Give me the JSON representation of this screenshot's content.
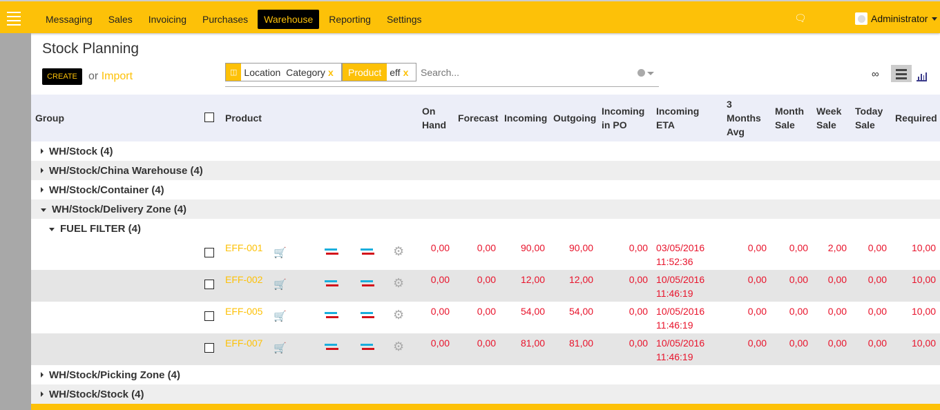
{
  "topbar": {
    "menu": [
      "Messaging",
      "Sales",
      "Invoicing",
      "Purchases",
      "Warehouse",
      "Reporting",
      "Settings"
    ],
    "active": "Warehouse",
    "user": "Administrator"
  },
  "page": {
    "title": "Stock Planning",
    "create": "CREATE",
    "or": "or",
    "import": "Import"
  },
  "search": {
    "facets": [
      {
        "label": "Location  Category"
      },
      {
        "label": "Product",
        "value": "eff"
      }
    ],
    "remove": "x",
    "placeholder": "Search..."
  },
  "views": {
    "infinity": "∞"
  },
  "columns": {
    "group": "Group",
    "product": "Product",
    "on_hand": "On Hand",
    "forecast": "Forecast",
    "incoming": "Incoming",
    "outgoing": "Outgoing",
    "incoming_po": "Incoming in PO",
    "incoming_eta": "Incoming ETA",
    "avg3": "3 Months Avg",
    "month": "Month Sale",
    "week": "Week Sale",
    "today": "Today Sale",
    "required": "Required"
  },
  "groups_before": [
    "WH/Stock (4)",
    "WH/Stock/China Warehouse (4)",
    "WH/Stock/Container (4)",
    "WH/Stock/Delivery Zone (4)"
  ],
  "subgroup": "FUEL FILTER (4)",
  "rows": [
    {
      "product": "EFF-001",
      "on_hand": "0,00",
      "forecast": "0,00",
      "incoming": "90,00",
      "outgoing": "90,00",
      "incoming_po": "0,00",
      "eta_date": "03/05/2016",
      "eta_time": "11:52:36",
      "avg3": "0,00",
      "month": "0,00",
      "week": "2,00",
      "today": "0,00",
      "required": "10,00"
    },
    {
      "product": "EFF-002",
      "on_hand": "0,00",
      "forecast": "0,00",
      "incoming": "12,00",
      "outgoing": "12,00",
      "incoming_po": "0,00",
      "eta_date": "10/05/2016",
      "eta_time": "11:46:19",
      "avg3": "0,00",
      "month": "0,00",
      "week": "0,00",
      "today": "0,00",
      "required": "10,00"
    },
    {
      "product": "EFF-005",
      "on_hand": "0,00",
      "forecast": "0,00",
      "incoming": "54,00",
      "outgoing": "54,00",
      "incoming_po": "0,00",
      "eta_date": "10/05/2016",
      "eta_time": "11:46:19",
      "avg3": "0,00",
      "month": "0,00",
      "week": "0,00",
      "today": "0,00",
      "required": "10,00"
    },
    {
      "product": "EFF-007",
      "on_hand": "0,00",
      "forecast": "0,00",
      "incoming": "81,00",
      "outgoing": "81,00",
      "incoming_po": "0,00",
      "eta_date": "10/05/2016",
      "eta_time": "11:46:19",
      "avg3": "0,00",
      "month": "0,00",
      "week": "0,00",
      "today": "0,00",
      "required": "10,00"
    }
  ],
  "groups_after": [
    "WH/Stock/Picking Zone (4)",
    "WH/Stock/Stock (4)"
  ]
}
